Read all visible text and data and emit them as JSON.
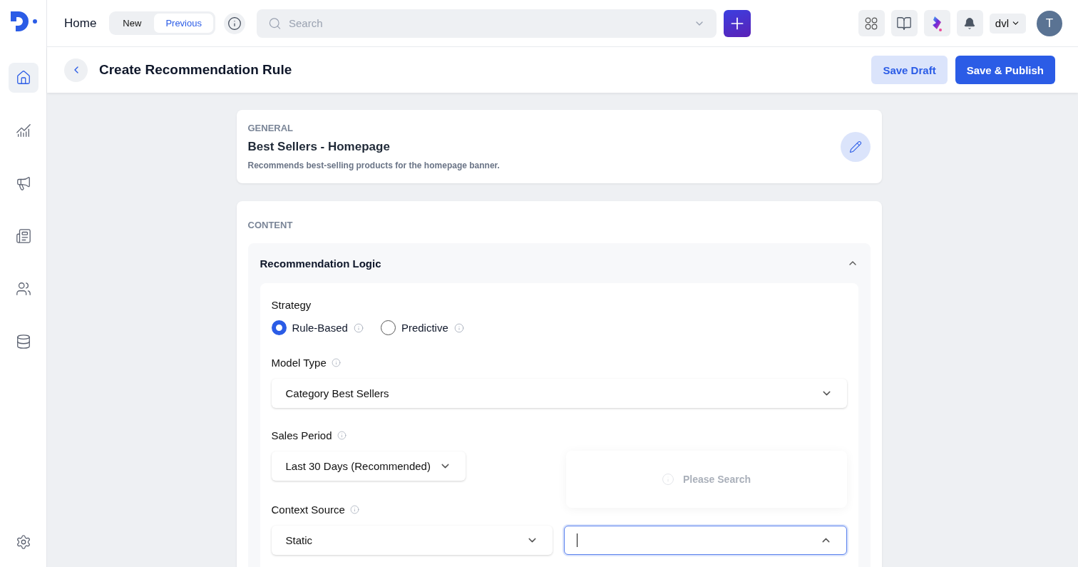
{
  "sidebar": {
    "items": [
      {
        "kind": "home",
        "selected": true
      },
      {
        "kind": "analytics",
        "selected": false
      },
      {
        "kind": "campaigns",
        "selected": false
      },
      {
        "kind": "content",
        "selected": false
      },
      {
        "kind": "audiences",
        "selected": false
      },
      {
        "kind": "data",
        "selected": false
      }
    ],
    "footer_items": [
      {
        "kind": "settings",
        "selected": false
      }
    ]
  },
  "topbar": {
    "title": "Home",
    "toggle": [
      {
        "label": "New",
        "selected": false
      },
      {
        "label": "Previous",
        "selected": true
      }
    ],
    "search": {
      "placeholder": "Search"
    },
    "workspace": "dvl",
    "avatar": "T"
  },
  "header": {
    "title": "Create Recommendation Rule",
    "buttons": [
      {
        "label": "Save Draft",
        "kind": "secondary"
      },
      {
        "label": "Save & Publish",
        "kind": "primary"
      }
    ]
  },
  "general": {
    "section": "GENERAL",
    "name": "Best Sellers - Homepage",
    "description": "Recommends best-selling products for the homepage banner."
  },
  "content": {
    "section": "CONTENT",
    "panel": {
      "title": "Recommendation Logic",
      "expanded": true,
      "strategy": {
        "label": "Strategy",
        "options": [
          {
            "label": "Rule-Based",
            "selected": true
          },
          {
            "label": "Predictive",
            "selected": false
          }
        ]
      },
      "model_type": {
        "label": "Model Type",
        "value": "Category Best Sellers"
      },
      "sales_period": {
        "label": "Sales Period",
        "value": "Last 30 Days (Recommended)"
      },
      "context_source": {
        "label": "Context Source",
        "value": "Static",
        "search": {
          "focused": true,
          "open": true,
          "empty_message": "Please Search"
        }
      }
    }
  }
}
